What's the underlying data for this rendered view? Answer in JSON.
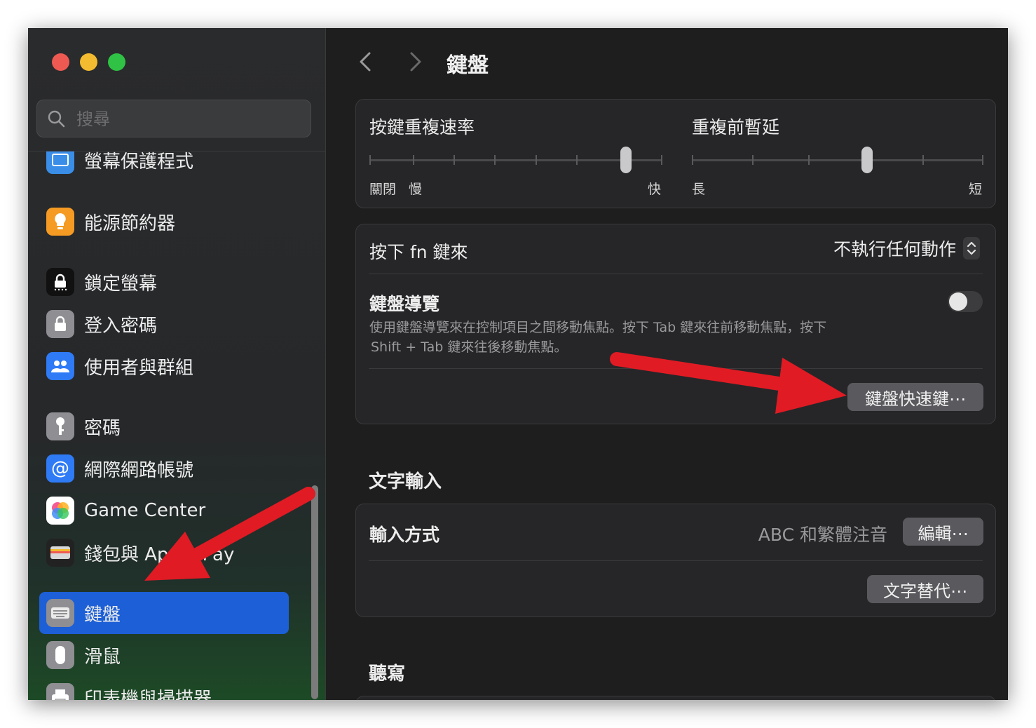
{
  "window": {
    "title": "鍵盤"
  },
  "sidebar": {
    "search_placeholder": "搜尋",
    "items": [
      {
        "label": "螢幕保護程式",
        "icon": "screensaver-icon",
        "color": "#3a8ee8"
      },
      {
        "label": "能源節約器",
        "icon": "lightbulb-icon",
        "color": "#f59a23"
      },
      {
        "label": "鎖定螢幕",
        "icon": "lock-screen-icon",
        "color": "#111111"
      },
      {
        "label": "登入密碼",
        "icon": "lock-icon",
        "color": "#8e8e93"
      },
      {
        "label": "使用者與群組",
        "icon": "users-icon",
        "color": "#2f7bf6"
      },
      {
        "label": "密碼",
        "icon": "key-icon",
        "color": "#8e8e93"
      },
      {
        "label": "網際網路帳號",
        "icon": "at-sign-icon",
        "color": "#2f7bf6"
      },
      {
        "label": "Game Center",
        "icon": "game-center-icon",
        "color": "#ffffff"
      },
      {
        "label": "錢包與 Apple Pay",
        "icon": "wallet-icon",
        "color": "#222222"
      },
      {
        "label": "鍵盤",
        "icon": "keyboard-icon",
        "color": "#8e8e93",
        "selected": true
      },
      {
        "label": "滑鼠",
        "icon": "mouse-icon",
        "color": "#8e8e93"
      },
      {
        "label": "印表機與掃描器",
        "icon": "printer-icon",
        "color": "#8e8e93"
      }
    ]
  },
  "main": {
    "title": "鍵盤",
    "key_repeat": {
      "label": "按鍵重複速率",
      "left_labels": [
        "關閉",
        "慢"
      ],
      "right_label": "快",
      "level": 0.875
    },
    "repeat_delay": {
      "label": "重複前暫延",
      "left_label": "長",
      "right_label": "短",
      "level": 0.6
    },
    "fn_key": {
      "label": "按下 fn 鍵來",
      "value": "不執行任何動作"
    },
    "keyboard_nav": {
      "label": "鍵盤導覽",
      "description_line1": "使用鍵盤導覽來在控制項目之間移動焦點。按下 Tab 鍵來往前移動焦點，按下",
      "description_line2": "Shift + Tab 鍵來往後移動焦點。",
      "enabled": false
    },
    "shortcuts_button": "鍵盤快速鍵⋯",
    "text_input": {
      "section_title": "文字輸入",
      "input_sources_label": "輸入方式",
      "input_sources_value": "ABC 和繁體注音",
      "edit_button": "編輯⋯",
      "text_replacements_button": "文字替代⋯"
    },
    "dictation": {
      "section_title": "聽寫"
    }
  },
  "annotations": {
    "arrow_color": "#e01b24"
  }
}
